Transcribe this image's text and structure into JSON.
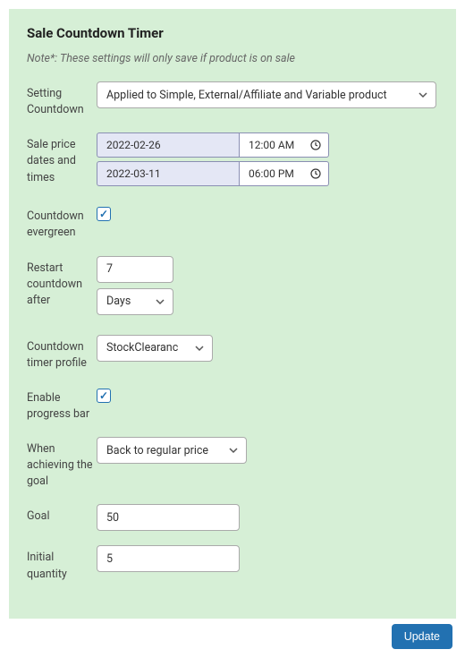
{
  "title": "Sale Countdown Timer",
  "note": "Note*: These settings will only save if product is on sale",
  "fields": {
    "setting": {
      "label": "Setting Countdown",
      "value": "Applied to Simple, External/Affiliate and Variable product"
    },
    "dates": {
      "label": "Sale price dates and times",
      "start_date": "2022-02-26",
      "start_time": "12:00 AM",
      "end_date": "2022-03-11",
      "end_time": "06:00 PM"
    },
    "evergreen": {
      "label": "Countdown evergreen",
      "checked": true
    },
    "restart": {
      "label": "Restart countdown after",
      "value": "7",
      "unit": "Days"
    },
    "profile": {
      "label": "Countdown timer profile",
      "value": "StockClearanc"
    },
    "progress": {
      "label": "Enable progress bar",
      "checked": true
    },
    "achieve": {
      "label": "When achieving the goal",
      "value": "Back to regular price"
    },
    "goal": {
      "label": "Goal",
      "value": "50"
    },
    "initial": {
      "label": "Initial quantity",
      "value": "5"
    }
  },
  "update_label": "Update"
}
